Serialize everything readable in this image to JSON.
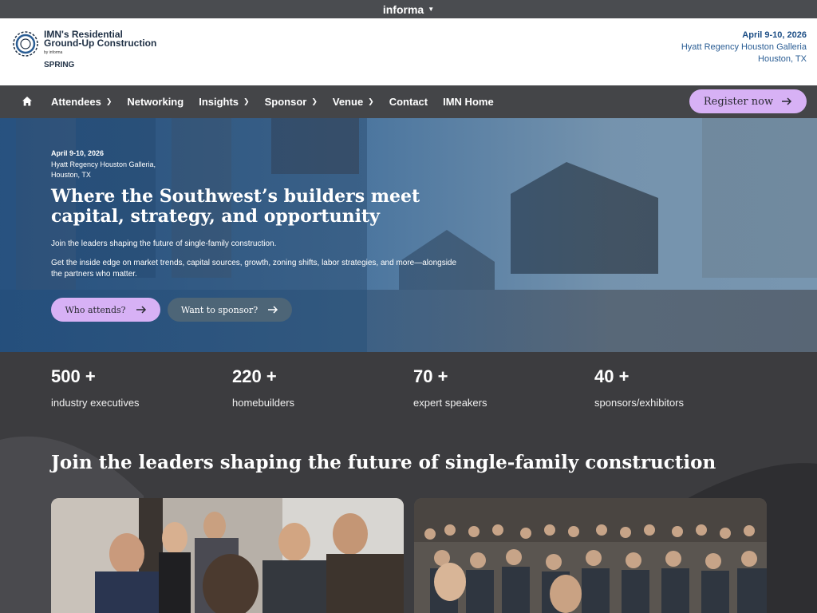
{
  "top_bar": {
    "brand": "informa",
    "caret_icon": "chevron-down-icon"
  },
  "header": {
    "logo": {
      "title_line1": "IMN's Residential",
      "title_line2": "Ground-Up Construction",
      "by": "by informa",
      "edition": "SPRING"
    },
    "date": "April 9-10, 2026",
    "venue": "Hyatt Regency Houston Galleria",
    "city": "Houston, TX"
  },
  "nav": {
    "home_icon": "home-icon",
    "items": [
      {
        "label": "Attendees",
        "dropdown": true
      },
      {
        "label": "Networking",
        "dropdown": false
      },
      {
        "label": "Insights",
        "dropdown": true
      },
      {
        "label": "Sponsor",
        "dropdown": true
      },
      {
        "label": "Venue",
        "dropdown": true
      },
      {
        "label": "Contact",
        "dropdown": false
      },
      {
        "label": "IMN Home",
        "dropdown": false
      }
    ],
    "register_label": "Register now"
  },
  "hero": {
    "date": "April 9-10, 2026",
    "venue_line1": "Hyatt Regency Houston Galleria,",
    "venue_line2": "Houston, TX",
    "title": "Where the Southwest’s builders meet capital, strategy, and opportunity",
    "lead": "Join the leaders shaping the future of single-family construction.",
    "body": "Get the inside edge on market trends, capital sources, growth, zoning shifts, labor strategies, and more—alongside the partners who matter.",
    "cta_primary": "Who attends?",
    "cta_secondary": "Want to sponsor?"
  },
  "stats": [
    {
      "value": "500",
      "suffix": "+",
      "label": "industry executives"
    },
    {
      "value": "220",
      "suffix": "+",
      "label": "homebuilders"
    },
    {
      "value": "70",
      "suffix": "+",
      "label": "expert speakers"
    },
    {
      "value": "40",
      "suffix": "+",
      "label": "sponsors/exhibitors"
    }
  ],
  "section": {
    "title": "Join the leaders shaping the future of single-family construction"
  },
  "colors": {
    "accent": "#d7b1f5",
    "nav_bg": "#444548",
    "header_text": "#2a5d94",
    "page_bg": "#3c3c3f"
  }
}
